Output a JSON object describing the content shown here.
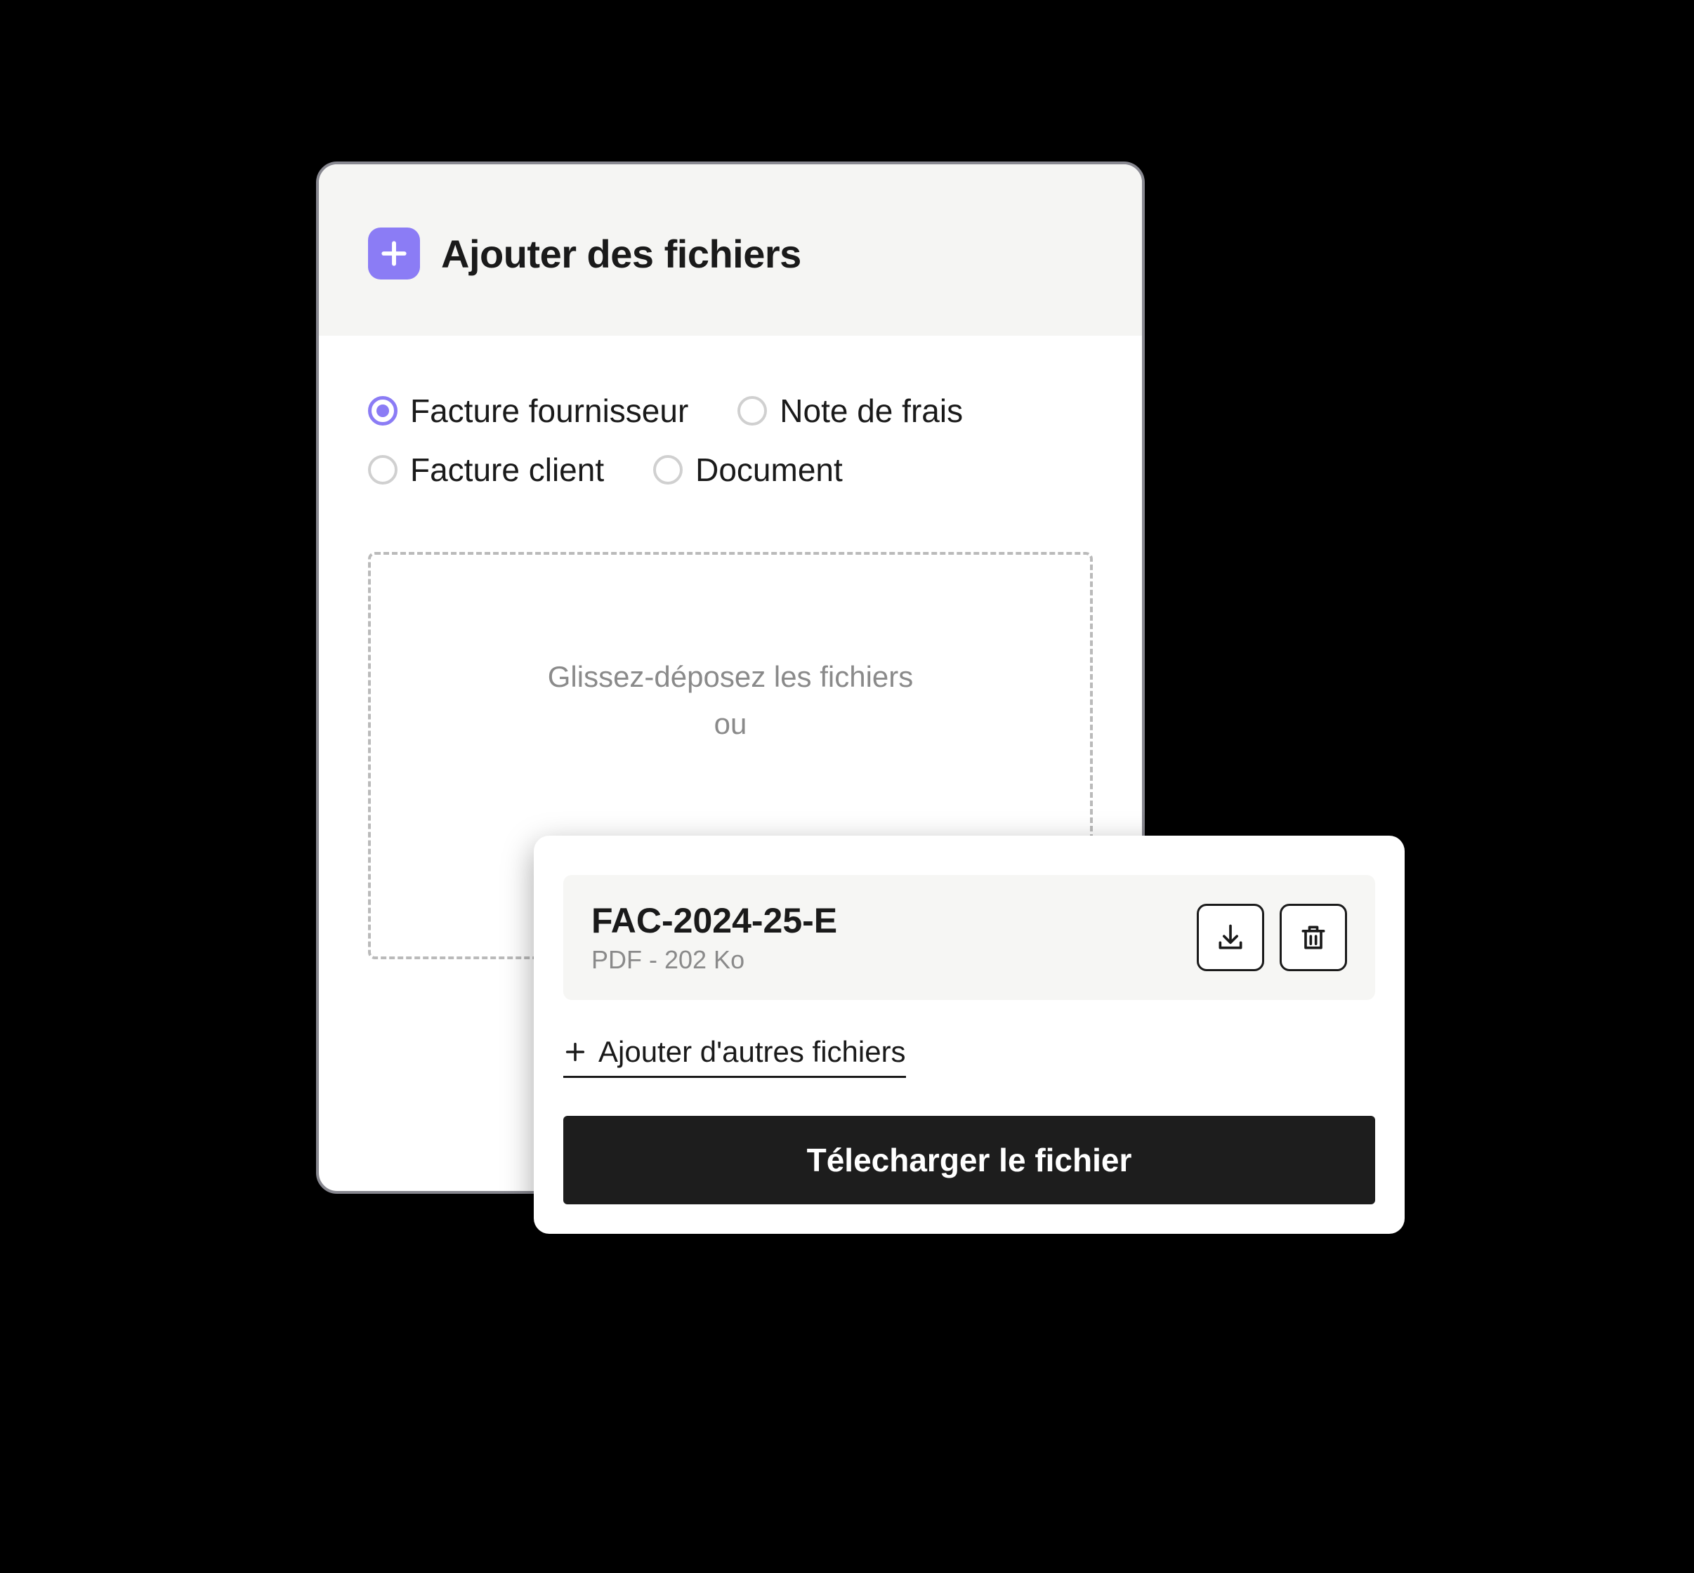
{
  "header": {
    "title": "Ajouter des fichiers"
  },
  "file_types": {
    "options": [
      {
        "label": "Facture fournisseur",
        "selected": true
      },
      {
        "label": "Note de frais",
        "selected": false
      },
      {
        "label": "Facture client",
        "selected": false
      },
      {
        "label": "Document",
        "selected": false
      }
    ]
  },
  "dropzone": {
    "line1": "Glissez-déposez les fichiers",
    "line2": "ou"
  },
  "overlay": {
    "file": {
      "name": "FAC-2024-25-E",
      "meta": "PDF - 202 Ko"
    },
    "add_more_label": "Ajouter d'autres fichiers",
    "download_label": "Télecharger le fichier"
  },
  "colors": {
    "accent": "#8b7cf5",
    "dark": "#1d1d1d",
    "muted": "#8a8a8a"
  }
}
